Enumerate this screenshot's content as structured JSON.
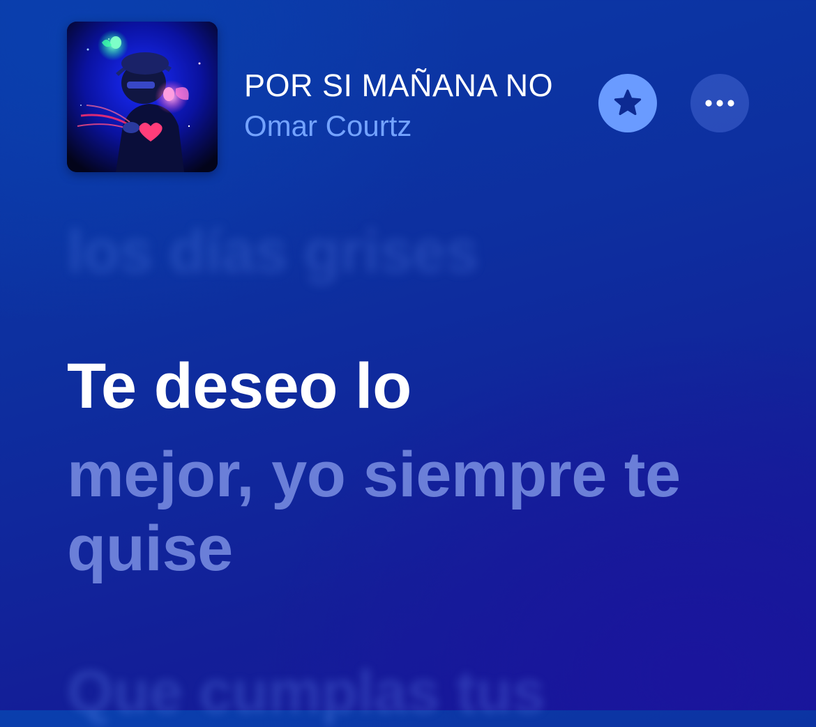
{
  "now_playing": {
    "title": "POR SI MAÑANA NO",
    "artist": "Omar Courtz",
    "favorite_icon": "star-icon",
    "more_icon": "ellipsis-icon"
  },
  "lyrics": {
    "previous_line": "los días grises",
    "current_line_active": "Te deseo lo",
    "current_line_rest": "mejor, yo siempre te quise",
    "next_line": "Que cumplas tus"
  },
  "colors": {
    "background": "#0d2f9f",
    "artist_text": "#74a3ff",
    "favorite_button": "#6a9bff",
    "lyric_active": "#ffffff",
    "lyric_upcoming": "#6b7fd8"
  }
}
